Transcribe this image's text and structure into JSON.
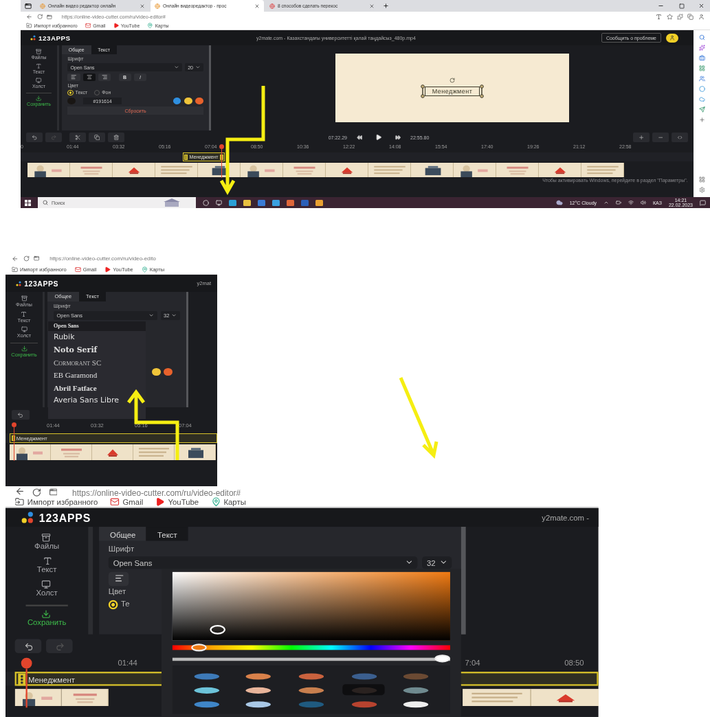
{
  "screenshots": [
    {
      "kind": "editor",
      "browser": {
        "tabs": [
          {
            "title": "Онлайн видео редактор онлайн",
            "selected": false
          },
          {
            "title": "Онлайн видеоредактор - прос",
            "selected": true
          },
          {
            "title": "8 способов сделать перекос",
            "selected": false
          }
        ],
        "url": "https://online-video-cutter.com/ru/video-editor#",
        "bookmarks": [
          "Импорт избранного",
          "Gmail",
          "YouTube",
          "Карты"
        ]
      },
      "app": {
        "logo": "123APPS",
        "file_title": "y2mate.com - Казахстандағы университетті қалай таңдайсыз_480p.mp4",
        "report_button": "Сообщить о проблеме",
        "sidebar": [
          {
            "label": "Файлы",
            "kind": "files"
          },
          {
            "label": "Текст",
            "kind": "text"
          },
          {
            "label": "Холст",
            "kind": "canvas"
          },
          {
            "label": "Сохранить",
            "kind": "save"
          }
        ],
        "panel": {
          "tabs": [
            {
              "label": "Общее",
              "selected": false
            },
            {
              "label": "Текст",
              "selected": true
            }
          ],
          "font_label": "Шрифт",
          "font": "Open Sans",
          "size": "20",
          "align": [
            {
              "selected": false
            },
            {
              "selected": true
            },
            {
              "selected": false
            }
          ],
          "bold": "B",
          "italic": "I",
          "color_label": "Цвет",
          "color_targets": [
            {
              "label": "Текст",
              "selected": true
            },
            {
              "label": "Фон",
              "selected": false
            }
          ],
          "hex": "#191614",
          "presets": [
            {
              "color": "#2f8fe0"
            },
            {
              "color": "#f0c53a"
            },
            {
              "color": "#e8622c"
            }
          ],
          "reset_button": "Сбросить"
        },
        "preview": {
          "caption": "Менеджмент"
        },
        "player": {
          "current_time": "07:22.29",
          "total_time": "22:55.80"
        },
        "ruler": [
          "0",
          "01:44",
          "03:32",
          "05:16",
          "07:04",
          "08:50",
          "10:36",
          "12:22",
          "14:08",
          "15:54",
          "17:40",
          "19:26",
          "21:12",
          "22:58"
        ],
        "text_clip": "Менеджмент",
        "activation_notice": "Чтобы активировать Windows, перейдите в раздел \"Параметры\"."
      },
      "taskbar": {
        "placeholder": "Поиск",
        "weather": "12°C Cloudy",
        "language": "КАЗ",
        "time": "14:21",
        "date": "22.02.2023"
      }
    },
    {
      "kind": "font_menu",
      "browser": {
        "url": "https://online-video-cutter.com/ru/video-edito",
        "bookmarks": [
          "Импорт избранного",
          "Gmail",
          "YouTube",
          "Карты"
        ]
      },
      "app": {
        "logo": "123APPS",
        "file_title": "y2mat",
        "sidebar": [
          {
            "label": "Файлы",
            "kind": "files"
          },
          {
            "label": "Текст",
            "kind": "text"
          },
          {
            "label": "Холст",
            "kind": "canvas"
          },
          {
            "label": "Сохранить",
            "kind": "save"
          }
        ],
        "panel": {
          "tabs": [
            {
              "label": "Общее",
              "selected": false
            },
            {
              "label": "Текст",
              "selected": true
            }
          ],
          "font_label": "Шрифт",
          "font": "Open Sans",
          "size": "32",
          "presets": [
            {
              "color": "#f0c53a"
            },
            {
              "color": "#e8622c"
            }
          ]
        },
        "ruler": [
          "01:44",
          "03:32",
          "05:16",
          "07:04"
        ],
        "text_clip": "Менеджмент"
      },
      "font_menu": {
        "options": [
          {
            "label": "Open Sans",
            "kind": "heading",
            "selected": true
          },
          {
            "label": "Rubik",
            "kind": "sans",
            "selected": false
          },
          {
            "label": "Noto Serif",
            "kind": "serif_bold",
            "selected": false
          },
          {
            "label": "Cormorant SC",
            "kind": "caps",
            "selected": false
          },
          {
            "label": "EB Garamond",
            "kind": "serif",
            "selected": false
          },
          {
            "label": "Abril Fatface",
            "kind": "display",
            "selected": false
          },
          {
            "label": "Averia Sans Libre",
            "kind": "sans",
            "selected": false
          }
        ]
      }
    },
    {
      "kind": "color_picker",
      "browser": {
        "url": "https://online-video-cutter.com/ru/video-editor#",
        "bookmarks": [
          "Импорт избранного",
          "Gmail",
          "YouTube",
          "Карты"
        ]
      },
      "app": {
        "logo": "123APPS",
        "file_title": "y2mate.com -",
        "sidebar": [
          {
            "label": "Файлы",
            "kind": "files"
          },
          {
            "label": "Текст",
            "kind": "text"
          },
          {
            "label": "Холст",
            "kind": "canvas"
          },
          {
            "label": "Сохранить",
            "kind": "save"
          }
        ],
        "panel": {
          "tabs": [
            {
              "label": "Общее",
              "selected": false
            },
            {
              "label": "Текст",
              "selected": true
            }
          ],
          "font_label": "Шрифт",
          "font": "Open Sans",
          "size": "32",
          "align": [
            {
              "selected": false
            }
          ],
          "color_label": "Цвет",
          "color_targets": [
            {
              "label": "Те",
              "selected": true
            }
          ]
        },
        "ruler": [
          "01:44",
          "7:04",
          "08:50"
        ],
        "text_clip": "Менеджмент"
      },
      "color_picker": {
        "hue": {
          "level": 0.07
        },
        "opacity": {
          "level": 1
        },
        "swatches": [
          {
            "color": "#3d7ab8",
            "selected": false
          },
          {
            "color": "#d9814a",
            "selected": false
          },
          {
            "color": "#c9623e",
            "selected": false
          },
          {
            "color": "#3b5f8f",
            "selected": false
          },
          {
            "color": "#6b4a33",
            "selected": false
          },
          {
            "color": "#6cc3d9",
            "selected": false
          },
          {
            "color": "#e8b49a",
            "selected": false
          },
          {
            "color": "#c87f4e",
            "selected": false
          },
          {
            "color": "#2a2220",
            "selected": true
          },
          {
            "color": "#6f8a8f",
            "selected": false
          },
          {
            "color": "#3f86c8",
            "selected": false
          },
          {
            "color": "#a9c8e6",
            "selected": false
          },
          {
            "color": "#1f5a80",
            "selected": false
          },
          {
            "color": "#b8432f",
            "selected": false
          },
          {
            "color": "#eeeeee",
            "selected": false
          }
        ]
      }
    }
  ]
}
